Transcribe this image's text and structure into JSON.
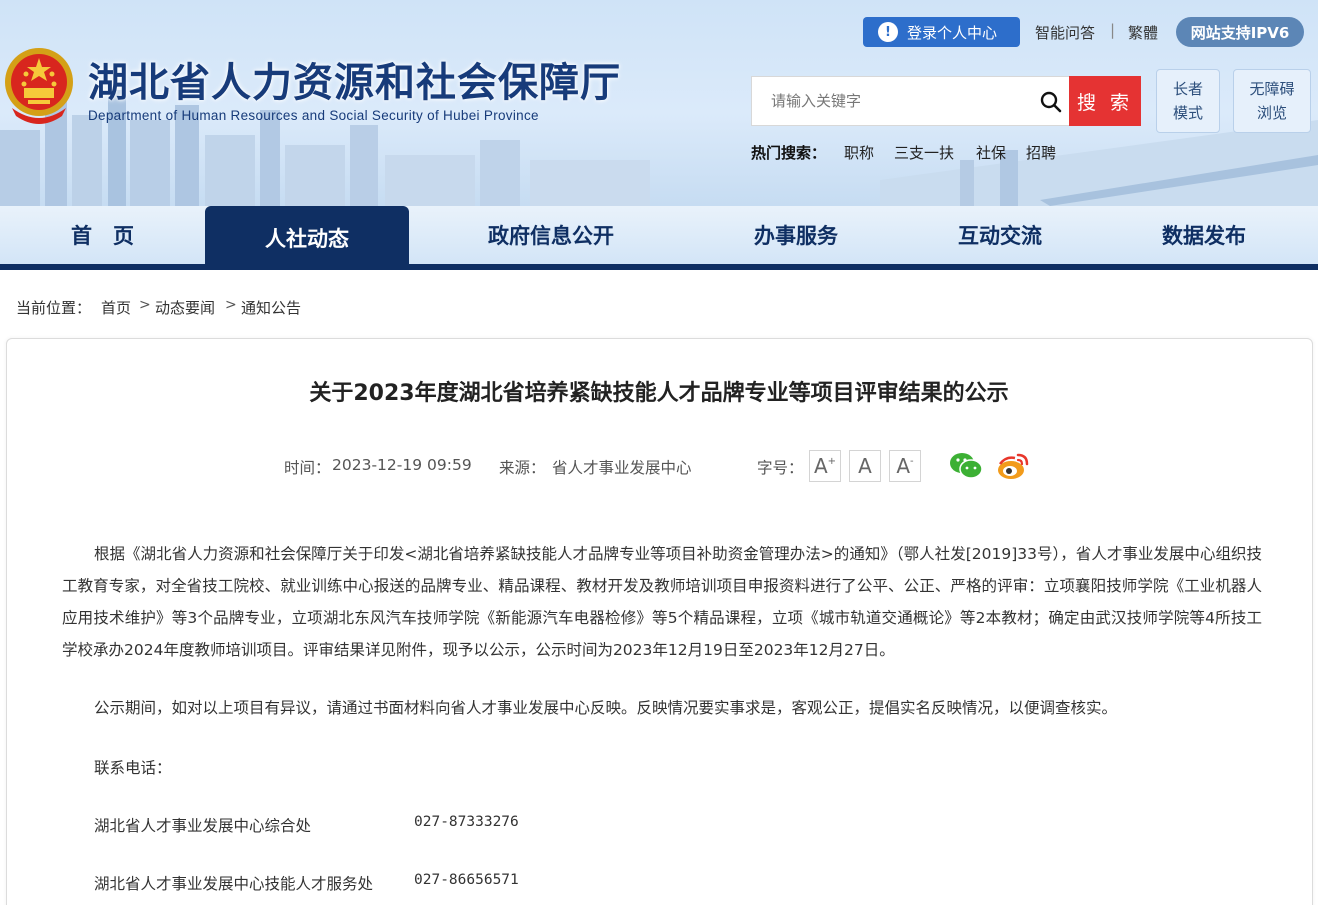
{
  "header": {
    "title": "湖北省人力资源和社会保障厅",
    "subtitle": "Department of Human Resources and Social Security of Hubei Province",
    "login_label": "登录个人中心",
    "qa_label": "智能问答",
    "traditional_label": "繁體",
    "ipv6_label": "网站支持IPV6",
    "search_placeholder": "请输入关键字",
    "search_button": "搜 索",
    "elder_mode": "长者模式",
    "accessible_browse": "无障碍浏览",
    "hot_label": "热门搜索：",
    "hot_items": [
      "职称",
      "三支一扶",
      "社保",
      "招聘"
    ]
  },
  "nav": {
    "items": [
      "首　页",
      "人社动态",
      "政府信息公开",
      "办事服务",
      "互动交流",
      "数据发布"
    ],
    "active": "人社动态"
  },
  "breadcrumb": {
    "label": "当前位置：",
    "items": [
      "首页",
      "动态要闻",
      "通知公告"
    ],
    "sep": ">"
  },
  "article": {
    "title": "关于2023年度湖北省培养紧缺技能人才品牌专业等项目评审结果的公示",
    "time_label": "时间：",
    "time": "2023-12-19 09:59",
    "source_label": "来源：",
    "source": "省人才事业发展中心",
    "font_label": "字号：",
    "font_buttons": [
      "A",
      "A",
      "A"
    ],
    "paragraph1": "根据《湖北省人力资源和社会保障厅关于印发<湖北省培养紧缺技能人才品牌专业等项目补助资金管理办法>的通知》（鄂人社发[2019]33号），省人才事业发展中心组织技工教育专家，对全省技工院校、就业训练中心报送的品牌专业、精品课程、教材开发及教师培训项目申报资料进行了公平、公正、严格的评审：立项襄阳技师学院《工业机器人应用技术维护》等3个品牌专业，立项湖北东风汽车技师学院《新能源汽车电器检修》等5个精品课程，立项《城市轨道交通概论》等2本教材；确定由武汉技师学院等4所技工学校承办2024年度教师培训项目。评审结果详见附件，现予以公示，公示时间为2023年12月19日至2023年12月27日。",
    "paragraph2": "公示期间，如对以上项目有异议，请通过书面材料向省人才事业发展中心反映。反映情况要实事求是，客观公正，提倡实名反映情况，以便调查核实。",
    "contact_label": "联系电话：",
    "contacts": [
      {
        "name": "湖北省人才事业发展中心综合处",
        "phone": "027-87333276"
      },
      {
        "name": "湖北省人才事业发展中心技能人才服务处",
        "phone": "027-86656571"
      }
    ]
  },
  "colors": {
    "nav_dark": "#0f2f63",
    "search_red": "#e53333",
    "login_blue": "#2d6ecb"
  }
}
